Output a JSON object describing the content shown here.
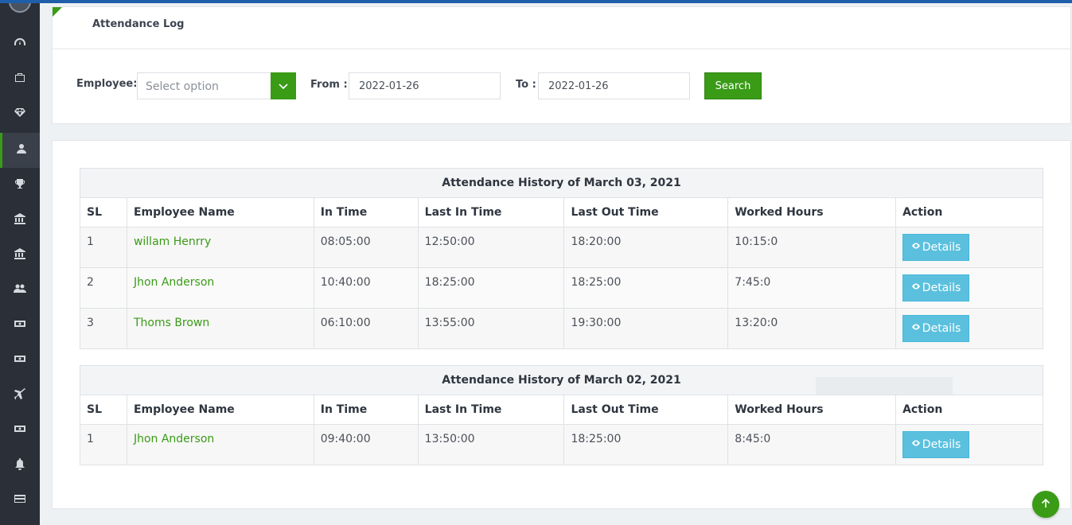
{
  "page": {
    "title": "Attendance Log"
  },
  "filters": {
    "employee_label": "Employee:",
    "employee_placeholder": "Select option",
    "from_label": "From :",
    "from_value": "2022-01-26",
    "to_label": "To :",
    "to_value": "2022-01-26",
    "search_label": "Search"
  },
  "sidebar": {
    "items": [
      {
        "icon": "dashboard-icon"
      },
      {
        "icon": "briefcase-icon"
      },
      {
        "icon": "diamond-icon"
      },
      {
        "icon": "user-icon",
        "active": true
      },
      {
        "icon": "trophy-icon"
      },
      {
        "icon": "bank-icon"
      },
      {
        "icon": "bank-icon"
      },
      {
        "icon": "users-icon"
      },
      {
        "icon": "money-icon"
      },
      {
        "icon": "money-icon"
      },
      {
        "icon": "plane-icon"
      },
      {
        "icon": "money-icon"
      },
      {
        "icon": "bell-icon"
      },
      {
        "icon": "credit-card-icon"
      }
    ]
  },
  "columns": [
    "SL",
    "Employee Name",
    "In Time",
    "Last In Time",
    "Last Out Time",
    "Worked Hours",
    "Action"
  ],
  "details_label": "Details",
  "tables": [
    {
      "caption": "Attendance History of March 03, 2021",
      "rows": [
        {
          "sl": "1",
          "name": "willam Henrry",
          "in": "08:05:00",
          "last_in": "12:50:00",
          "last_out": "18:20:00",
          "worked": "10:15:0"
        },
        {
          "sl": "2",
          "name": "Jhon Anderson",
          "in": "10:40:00",
          "last_in": "18:25:00",
          "last_out": "18:25:00",
          "worked": "7:45:0"
        },
        {
          "sl": "3",
          "name": "Thoms Brown",
          "in": "06:10:00",
          "last_in": "13:55:00",
          "last_out": "19:30:00",
          "worked": "13:20:0"
        }
      ]
    },
    {
      "caption": "Attendance History of March 02, 2021",
      "rows": [
        {
          "sl": "1",
          "name": "Jhon Anderson",
          "in": "09:40:00",
          "last_in": "13:50:00",
          "last_out": "18:25:00",
          "worked": "8:45:0"
        }
      ]
    }
  ],
  "colors": {
    "accent": "#3a9b17",
    "info": "#5bc0de",
    "sidebar": "#2b3038"
  }
}
